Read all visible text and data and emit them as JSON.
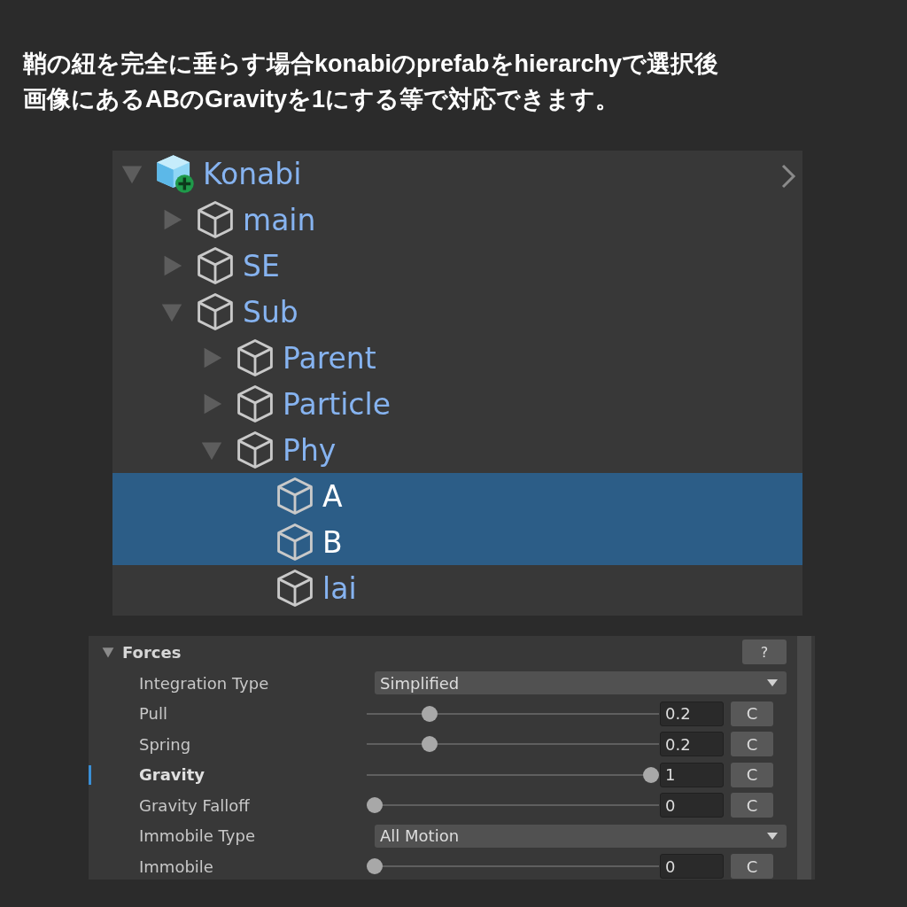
{
  "caption": {
    "lines": [
      "鞘の紐を完全に垂らす場合konabiのprefabをhierarchyで選択後",
      "画像にあるABのGravityを1にする等で対応できます。"
    ]
  },
  "hierarchy": {
    "items": [
      {
        "name": "Konabi",
        "kind": "prefab",
        "expanded": true,
        "selected": false,
        "children": [
          {
            "name": "main",
            "kind": "object",
            "expanded": false,
            "selected": false
          },
          {
            "name": "SE",
            "kind": "object",
            "expanded": false,
            "selected": false
          },
          {
            "name": "Sub",
            "kind": "object",
            "expanded": true,
            "selected": false,
            "children": [
              {
                "name": "Parent",
                "kind": "object",
                "expanded": false,
                "selected": false
              },
              {
                "name": "Particle",
                "kind": "object",
                "expanded": false,
                "selected": false
              },
              {
                "name": "Phy",
                "kind": "object",
                "expanded": true,
                "selected": false,
                "children": [
                  {
                    "name": "A",
                    "kind": "object",
                    "selected": true
                  },
                  {
                    "name": "B",
                    "kind": "object",
                    "selected": true
                  },
                  {
                    "name": "lai",
                    "kind": "object",
                    "selected": false
                  }
                ]
              }
            ]
          }
        ]
      }
    ]
  },
  "forces": {
    "title": "Forces",
    "expanded": true,
    "help": "?",
    "rows": [
      {
        "kind": "dropdown",
        "label": "Integration Type",
        "value": "Simplified",
        "highlighted": false
      },
      {
        "kind": "slider",
        "label": "Pull",
        "level": 0.2,
        "value": "0.2",
        "button": "C",
        "highlighted": false
      },
      {
        "kind": "slider",
        "label": "Spring",
        "level": 0.2,
        "value": "0.2",
        "button": "C",
        "highlighted": false
      },
      {
        "kind": "slider",
        "label": "Gravity",
        "level": 1,
        "value": "1",
        "button": "C",
        "highlighted": true
      },
      {
        "kind": "slider",
        "label": "Gravity Falloff",
        "level": 0,
        "value": "0",
        "button": "C",
        "highlighted": false
      },
      {
        "kind": "dropdown",
        "label": "Immobile Type",
        "value": "All Motion",
        "highlighted": false
      },
      {
        "kind": "slider",
        "label": "Immobile",
        "level": 0,
        "value": "0",
        "button": "C",
        "highlighted": false
      }
    ]
  }
}
